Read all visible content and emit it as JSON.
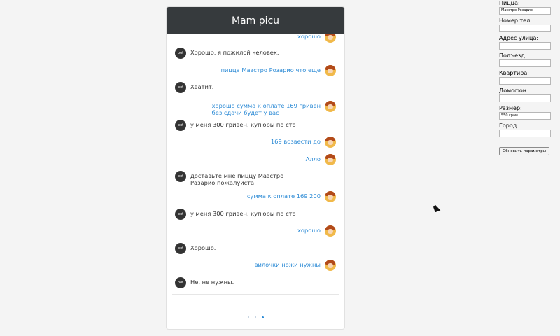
{
  "chat": {
    "title": "Mam picu",
    "messages": [
      {
        "sender": "user",
        "text": "хорошо"
      },
      {
        "sender": "bot",
        "text": "Хорошо, я пожилой человек."
      },
      {
        "sender": "user",
        "text": "пицца Маэстро Розарио что еще"
      },
      {
        "sender": "bot",
        "text": "Хватит."
      },
      {
        "sender": "user",
        "text": "хорошо сумма к оплате 169 гривен\nбез сдачи будет у вас"
      },
      {
        "sender": "bot",
        "text": "у меня 300 гривен, купюры по сто"
      },
      {
        "sender": "user",
        "text": "169 возвести до"
      },
      {
        "sender": "user",
        "text": "Алло"
      },
      {
        "sender": "bot",
        "text": "доставьте мне пиццу Маэстро\nРазарио пожалуйста"
      },
      {
        "sender": "user",
        "text": "сумма к оплате 169 200"
      },
      {
        "sender": "bot",
        "text": "у меня 300 гривен, купюры по сто"
      },
      {
        "sender": "user",
        "text": "хорошо"
      },
      {
        "sender": "bot",
        "text": "Хорошо."
      },
      {
        "sender": "user",
        "text": "вилочки ножи нужны"
      },
      {
        "sender": "bot",
        "text": "Не, не нужны."
      }
    ],
    "bot_avatar_text": "bot",
    "typing_indicator_active_dot": 3
  },
  "form": {
    "fields": [
      {
        "label": "Пицца:",
        "value": "Маэстро Розарио"
      },
      {
        "label": "Номер тел:",
        "value": ""
      },
      {
        "label": "Адрес улица:",
        "value": ""
      },
      {
        "label": "Подъезд:",
        "value": ""
      },
      {
        "label": "Квартира:",
        "value": ""
      },
      {
        "label": "Домофон:",
        "value": ""
      },
      {
        "label": "Размер:",
        "value": "550 грам"
      },
      {
        "label": "Город:",
        "value": ""
      }
    ],
    "update_button": "Обновить параметры"
  }
}
